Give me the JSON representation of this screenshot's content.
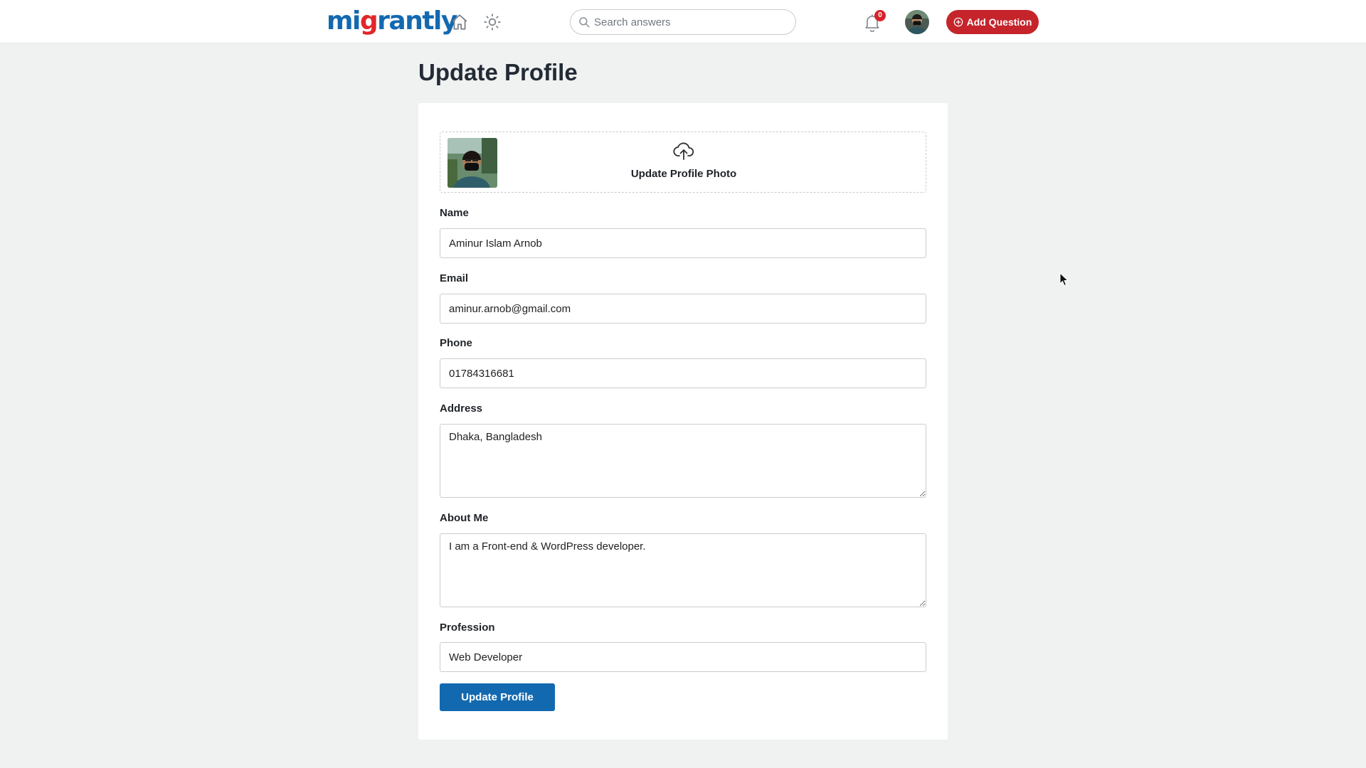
{
  "header": {
    "logo": {
      "part1": "mi",
      "part2": "g",
      "part3": "rantly"
    },
    "search": {
      "placeholder": "Search answers"
    },
    "notifications": {
      "count": "0"
    },
    "add_question_label": "Add Question",
    "icons": [
      "home-icon",
      "sun-icon",
      "search-icon",
      "bell-icon",
      "plus-circle-icon"
    ]
  },
  "page": {
    "title": "Update Profile"
  },
  "profile_form": {
    "photo_label": "Update Profile Photo",
    "fields": {
      "name": {
        "label": "Name",
        "value": "Aminur Islam Arnob"
      },
      "email": {
        "label": "Email",
        "value": "aminur.arnob@gmail.com"
      },
      "phone": {
        "label": "Phone",
        "value": "01784316681"
      },
      "address": {
        "label": "Address",
        "value": "Dhaka, Bangladesh"
      },
      "about": {
        "label": "About Me",
        "value": "I am a Front-end & WordPress developer."
      },
      "profession": {
        "label": "Profession",
        "value": "Web Developer"
      }
    },
    "submit_label": "Update Profile"
  },
  "colors": {
    "brand_blue": "#1369b0",
    "brand_red": "#e2262b",
    "add_button": "#c5242b",
    "page_bg": "#f0f2f1"
  }
}
